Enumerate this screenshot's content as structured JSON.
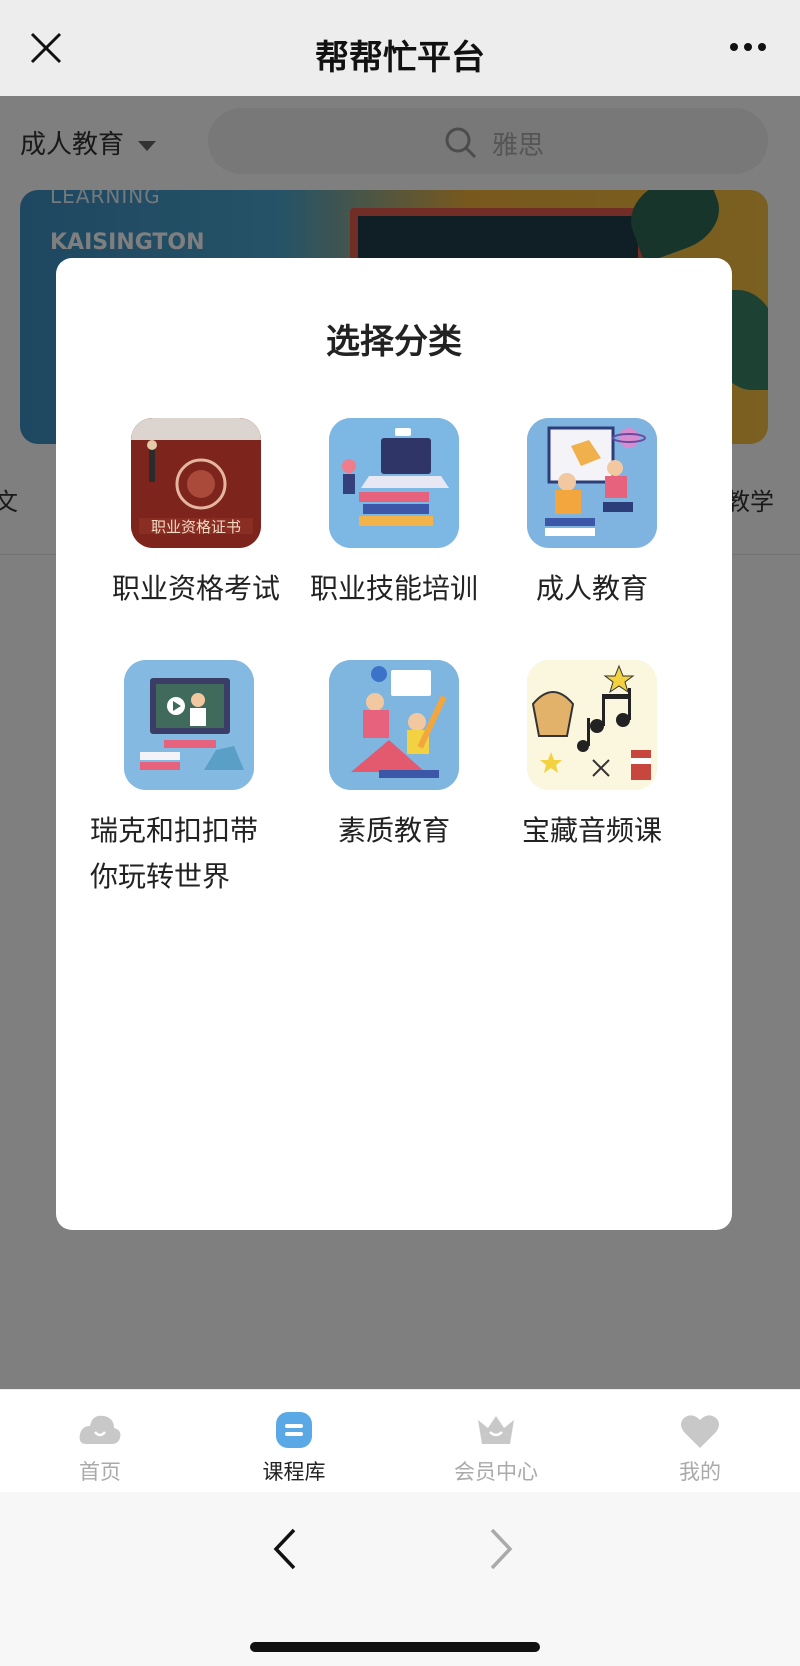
{
  "topbar": {
    "title": "帮帮忙平台"
  },
  "page": {
    "category_select": "成人教育",
    "search_placeholder": "雅思",
    "banner": {
      "line1": "LEARNING",
      "line2": "KAISINGTON"
    },
    "side_left": "文",
    "side_right": "教学"
  },
  "modal": {
    "title": "选择分类",
    "categories": [
      {
        "label": "职业资格考试",
        "icon": "certificate-image"
      },
      {
        "label": "职业技能培训",
        "icon": "laptop-training-image"
      },
      {
        "label": "成人教育",
        "icon": "adult-education-image"
      },
      {
        "label_line1": "瑞克和扣扣带",
        "label_line2": "你玩转世界",
        "icon": "online-class-image"
      },
      {
        "label": "素质教育",
        "icon": "quality-education-image"
      },
      {
        "label": "宝藏音频课",
        "icon": "music-notes-image"
      }
    ]
  },
  "tabbar": {
    "items": [
      {
        "label": "首页",
        "icon": "cloud-home-icon",
        "active": false
      },
      {
        "label": "课程库",
        "icon": "course-library-icon",
        "active": true
      },
      {
        "label": "会员中心",
        "icon": "member-crown-icon",
        "active": false
      },
      {
        "label": "我的",
        "icon": "heart-profile-icon",
        "active": false
      }
    ]
  },
  "colors": {
    "accent": "#5aa9e6",
    "mask": "rgba(0,0,0,0.5)",
    "inactive": "#aaaaaa"
  }
}
